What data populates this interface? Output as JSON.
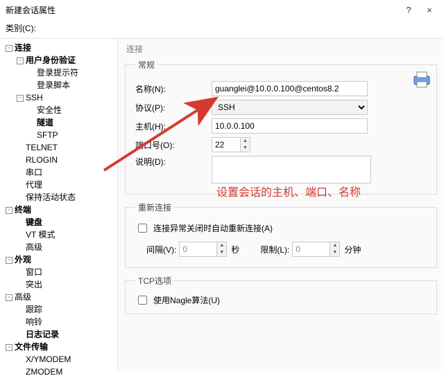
{
  "window": {
    "title": "新建会话属性",
    "help": "?",
    "close": "×",
    "category_label": "类别(C):"
  },
  "tree": [
    {
      "label": "连接",
      "level": 1,
      "bold": true,
      "expand": "-"
    },
    {
      "label": "用户身份验证",
      "level": 2,
      "bold": true,
      "expand": "-"
    },
    {
      "label": "登录提示符",
      "level": 3,
      "bold": false,
      "expand": ""
    },
    {
      "label": "登录脚本",
      "level": 3,
      "bold": false,
      "expand": ""
    },
    {
      "label": "SSH",
      "level": 2,
      "bold": false,
      "expand": "-"
    },
    {
      "label": "安全性",
      "level": 3,
      "bold": false,
      "expand": ""
    },
    {
      "label": "隧道",
      "level": 3,
      "bold": true,
      "expand": ""
    },
    {
      "label": "SFTP",
      "level": 3,
      "bold": false,
      "expand": ""
    },
    {
      "label": "TELNET",
      "level": 2,
      "bold": false,
      "expand": ""
    },
    {
      "label": "RLOGIN",
      "level": 2,
      "bold": false,
      "expand": ""
    },
    {
      "label": "串口",
      "level": 2,
      "bold": false,
      "expand": ""
    },
    {
      "label": "代理",
      "level": 2,
      "bold": false,
      "expand": ""
    },
    {
      "label": "保持活动状态",
      "level": 2,
      "bold": false,
      "expand": ""
    },
    {
      "label": "终端",
      "level": 1,
      "bold": true,
      "expand": "-"
    },
    {
      "label": "键盘",
      "level": 2,
      "bold": true,
      "expand": ""
    },
    {
      "label": "VT 模式",
      "level": 2,
      "bold": false,
      "expand": ""
    },
    {
      "label": "高级",
      "level": 2,
      "bold": false,
      "expand": ""
    },
    {
      "label": "外观",
      "level": 1,
      "bold": true,
      "expand": "-"
    },
    {
      "label": "窗口",
      "level": 2,
      "bold": false,
      "expand": ""
    },
    {
      "label": "突出",
      "level": 2,
      "bold": false,
      "expand": ""
    },
    {
      "label": "高级",
      "level": 1,
      "bold": false,
      "expand": "-"
    },
    {
      "label": "跟踪",
      "level": 2,
      "bold": false,
      "expand": ""
    },
    {
      "label": "响铃",
      "level": 2,
      "bold": false,
      "expand": ""
    },
    {
      "label": "日志记录",
      "level": 2,
      "bold": true,
      "expand": ""
    },
    {
      "label": "文件传输",
      "level": 1,
      "bold": true,
      "expand": "-"
    },
    {
      "label": "X/YMODEM",
      "level": 2,
      "bold": false,
      "expand": ""
    },
    {
      "label": "ZMODEM",
      "level": 2,
      "bold": false,
      "expand": ""
    }
  ],
  "panel_tab": "连接",
  "general": {
    "legend": "常规",
    "name_label": "名称(N):",
    "name_value": "guanglei@10.0.0.100@centos8.2",
    "protocol_label": "协议(P):",
    "protocol_value": "SSH",
    "host_label": "主机(H):",
    "host_value": "10.0.0.100",
    "port_label": "端口号(O):",
    "port_value": "22",
    "desc_label": "说明(D):"
  },
  "annotation": "设置会话的主机、端口、名称",
  "reconnect": {
    "legend": "重新连接",
    "auto_label": "连接异常关闭时自动重新连接(A)",
    "interval_label": "间隔(V):",
    "interval_value": "0",
    "interval_unit": "秒",
    "limit_label": "限制(L):",
    "limit_value": "0",
    "limit_unit": "分钟"
  },
  "tcp": {
    "legend": "TCP选项",
    "nagle_label": "使用Nagle算法(U)"
  }
}
